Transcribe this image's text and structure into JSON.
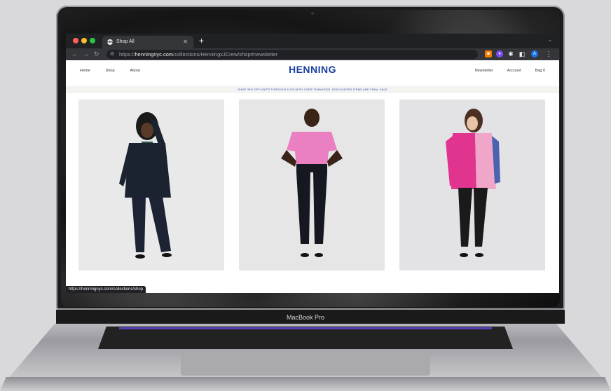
{
  "browser": {
    "tab_title": "Shop All",
    "favicon_text": "HEN",
    "url_protocol": "https://",
    "url_host": "henningnyc.com",
    "url_path": "/collections/HenningxJCrew/shop#newsletter",
    "profile_initial": "A",
    "status_url": "https://henningnyc.com/collections/shop"
  },
  "site": {
    "logo": "HENNING",
    "nav_left": [
      "Home",
      "Shop",
      "About"
    ],
    "nav_right": [
      "Newsletter",
      "Account",
      "Bag 0"
    ],
    "promo": "SHOP 30% OFF KNITS THROUGH 11/03 WITH CODE THANKSGG. DISCOUNTED ITEMS ARE FINAL SALE",
    "brand_color": "#1a3fa0"
  },
  "products": [
    {
      "name": "black-suit-model"
    },
    {
      "name": "pink-tee-model"
    },
    {
      "name": "pink-cardigan-model"
    }
  ],
  "device": {
    "label": "MacBook Pro"
  }
}
